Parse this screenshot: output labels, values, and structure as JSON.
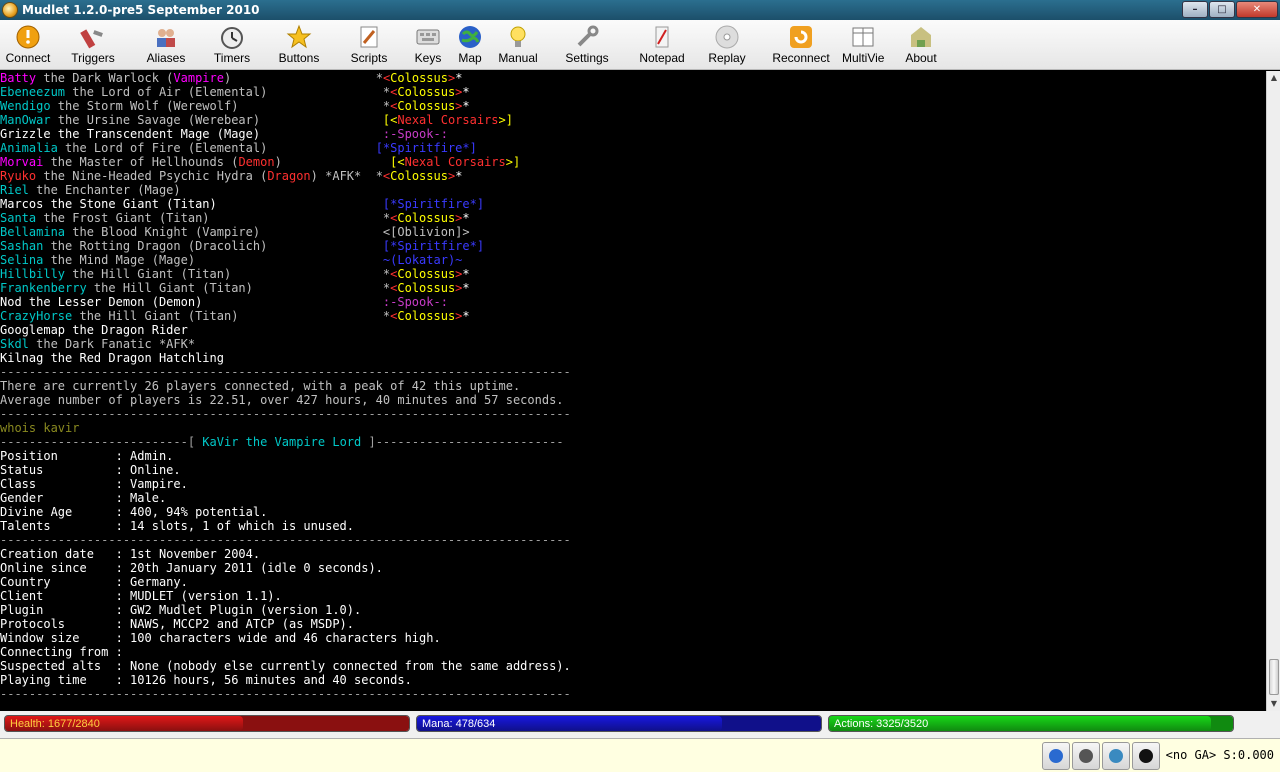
{
  "window": {
    "title": "Mudlet 1.2.0-pre5 September 2010"
  },
  "toolbar": [
    {
      "name": "connect",
      "label": "Connect"
    },
    {
      "name": "triggers",
      "label": "Triggers"
    },
    {
      "name": "aliases",
      "label": "Aliases"
    },
    {
      "name": "timers",
      "label": "Timers"
    },
    {
      "name": "buttons",
      "label": "Buttons"
    },
    {
      "name": "scripts",
      "label": "Scripts"
    },
    {
      "name": "keys",
      "label": "Keys"
    },
    {
      "name": "map",
      "label": "Map"
    },
    {
      "name": "manual",
      "label": "Manual"
    },
    {
      "name": "settings",
      "label": "Settings"
    },
    {
      "name": "notepad",
      "label": "Notepad"
    },
    {
      "name": "replay",
      "label": "Replay"
    },
    {
      "name": "reconnect",
      "label": "Reconnect"
    },
    {
      "name": "multiview",
      "label": "MultiView"
    },
    {
      "name": "about",
      "label": "About"
    }
  ],
  "colors": {
    "magenta": "#ff00ff",
    "cyan": "#00c8c8",
    "red": "#ff3030",
    "white": "#ffffff",
    "yellow": "#ffff00",
    "blue": "#3a3aff",
    "spook": "#c83cc8",
    "dash": "#a0a0a0",
    "cmd": "#8a8a20",
    "grey": "#c0c0c0"
  },
  "console": {
    "lines": [
      [
        [
          "Batty",
          "magenta"
        ],
        [
          " the Dark Warlock (",
          "grey"
        ],
        [
          "Vampire",
          "magenta"
        ],
        [
          ")                    *",
          "grey"
        ],
        [
          "<",
          "red"
        ],
        [
          "Colossus",
          "yellow"
        ],
        [
          ">",
          "red"
        ],
        [
          "*",
          "white"
        ]
      ],
      [
        [
          "Ebeneezum",
          "cyan"
        ],
        [
          " the Lord of Air (Elemental)                *",
          "grey"
        ],
        [
          "<",
          "red"
        ],
        [
          "Colossus",
          "yellow"
        ],
        [
          ">",
          "red"
        ],
        [
          "*",
          "white"
        ]
      ],
      [
        [
          "Wendigo",
          "cyan"
        ],
        [
          " the Storm Wolf (Werewolf)                    *",
          "grey"
        ],
        [
          "<",
          "red"
        ],
        [
          "Colossus",
          "yellow"
        ],
        [
          ">",
          "red"
        ],
        [
          "*",
          "white"
        ]
      ],
      [
        [
          "ManOwar",
          "cyan"
        ],
        [
          " the Ursine Savage (Werebear)                 ",
          "grey"
        ],
        [
          "[<",
          "yellow"
        ],
        [
          "Nexal Corsairs",
          "red"
        ],
        [
          ">]",
          "yellow"
        ]
      ],
      [
        [
          "Grizzle the Transcendent Mage (Mage)                 ",
          "white"
        ],
        [
          ":-Spook-:",
          "spook"
        ]
      ],
      [
        [
          "Animalia",
          "cyan"
        ],
        [
          " the Lord of Fire (Elemental)               ",
          "grey"
        ],
        [
          "[*Spiritfire*]",
          "blue"
        ]
      ],
      [
        [
          "Morvai",
          "magenta"
        ],
        [
          " the Master of Hellhounds (",
          "grey"
        ],
        [
          "Demon",
          "red"
        ],
        [
          ")               ",
          "grey"
        ],
        [
          "[<",
          "yellow"
        ],
        [
          "Nexal Corsairs",
          "red"
        ],
        [
          ">]",
          "yellow"
        ]
      ],
      [
        [
          "Ryuko",
          "red"
        ],
        [
          " the Nine-Headed Psychic Hydra (",
          "grey"
        ],
        [
          "Dragon",
          "red"
        ],
        [
          ") *AFK*  *",
          "grey"
        ],
        [
          "<",
          "red"
        ],
        [
          "Colossus",
          "yellow"
        ],
        [
          ">",
          "red"
        ],
        [
          "*",
          "white"
        ]
      ],
      [
        [
          "Riel",
          "cyan"
        ],
        [
          " the Enchanter (Mage)",
          "grey"
        ]
      ],
      [
        [
          "Marcos the Stone Giant (Titan)                       ",
          "white"
        ],
        [
          "[*Spiritfire*]",
          "blue"
        ]
      ],
      [
        [
          "Santa",
          "cyan"
        ],
        [
          " the Frost Giant (Titan)                        *",
          "grey"
        ],
        [
          "<",
          "red"
        ],
        [
          "Colossus",
          "yellow"
        ],
        [
          ">",
          "red"
        ],
        [
          "*",
          "white"
        ]
      ],
      [
        [
          "Bellamina",
          "cyan"
        ],
        [
          " the Blood Knight (Vampire)                 <[Oblivion]>",
          "grey"
        ]
      ],
      [
        [
          "Sashan",
          "cyan"
        ],
        [
          " the Rotting Dragon (Dracolich)                ",
          "grey"
        ],
        [
          "[*Spiritfire*]",
          "blue"
        ]
      ],
      [
        [
          "Selina",
          "cyan"
        ],
        [
          " the Mind Mage (Mage)                          ",
          "grey"
        ],
        [
          "~(Lokatar)~",
          "blue"
        ]
      ],
      [
        [
          "Hillbilly",
          "cyan"
        ],
        [
          " the Hill Giant (Titan)                     *",
          "grey"
        ],
        [
          "<",
          "red"
        ],
        [
          "Colossus",
          "yellow"
        ],
        [
          ">",
          "red"
        ],
        [
          "*",
          "white"
        ]
      ],
      [
        [
          "Frankenberry",
          "cyan"
        ],
        [
          " the Hill Giant (Titan)                  *",
          "grey"
        ],
        [
          "<",
          "red"
        ],
        [
          "Colossus",
          "yellow"
        ],
        [
          ">",
          "red"
        ],
        [
          "*",
          "white"
        ]
      ],
      [
        [
          "Nod the Lesser Demon (Demon)                         ",
          "white"
        ],
        [
          ":-Spook-:",
          "spook"
        ]
      ],
      [
        [
          "CrazyHorse",
          "cyan"
        ],
        [
          " the Hill Giant (Titan)                    *",
          "grey"
        ],
        [
          "<",
          "red"
        ],
        [
          "Colossus",
          "yellow"
        ],
        [
          ">",
          "red"
        ],
        [
          "*",
          "white"
        ]
      ],
      [
        [
          "Googlemap the Dragon Rider",
          "white"
        ]
      ],
      [
        [
          "Skdl",
          "cyan"
        ],
        [
          " the Dark Fanatic *AFK*",
          "grey"
        ]
      ],
      [
        [
          "Kilnag the Red Dragon Hatchling",
          "white"
        ]
      ],
      [
        [
          "-------------------------------------------------------------------------------",
          "dash"
        ]
      ],
      [
        [
          "There are currently 26 players connected, with a peak of 42 this uptime.",
          "grey"
        ]
      ],
      [
        [
          "Average number of players is 22.51, over 427 hours, 40 minutes and 57 seconds.",
          "grey"
        ]
      ],
      [
        [
          "-------------------------------------------------------------------------------",
          "dash"
        ]
      ],
      [
        [
          "whois kavir",
          "cmd"
        ]
      ],
      [
        [
          "--------------------------[ ",
          "dash"
        ],
        [
          "KaVir the Vampire Lord",
          "cyan"
        ],
        [
          " ]--------------------------",
          "dash"
        ]
      ],
      [
        [
          "Position        : Admin.",
          "white"
        ]
      ],
      [
        [
          "Status          : Online.",
          "white"
        ]
      ],
      [
        [
          "Class           : Vampire.",
          "white"
        ]
      ],
      [
        [
          "Gender          : Male.",
          "white"
        ]
      ],
      [
        [
          "Divine Age      : 400, 94% potential.",
          "white"
        ]
      ],
      [
        [
          "Talents         : 14 slots, 1 of which is unused.",
          "white"
        ]
      ],
      [
        [
          "-------------------------------------------------------------------------------",
          "dash"
        ]
      ],
      [
        [
          "Creation date   : 1st November 2004.",
          "white"
        ]
      ],
      [
        [
          "Online since    : 20th January 2011 (idle 0 seconds).",
          "white"
        ]
      ],
      [
        [
          "Country         : Germany.",
          "white"
        ]
      ],
      [
        [
          "Client          : MUDLET (version 1.1).",
          "white"
        ]
      ],
      [
        [
          "Plugin          : GW2 Mudlet Plugin (version 1.0).",
          "white"
        ]
      ],
      [
        [
          "Protocols       : NAWS, MCCP2 and ATCP (as MSDP).",
          "white"
        ]
      ],
      [
        [
          "Window size     : 100 characters wide and 46 characters high.",
          "white"
        ]
      ],
      [
        [
          "Connecting from :",
          "white"
        ]
      ],
      [
        [
          "Suspected alts  : None (nobody else currently connected from the same address).",
          "white"
        ]
      ],
      [
        [
          "Playing time    : 10126 hours, 56 minutes and 40 seconds.",
          "white"
        ]
      ],
      [
        [
          "-------------------------------------------------------------------------------",
          "dash"
        ]
      ]
    ]
  },
  "gauges": [
    {
      "name": "health",
      "label": "Health: 1677/2840",
      "fraction": 0.59,
      "fill": "#e01818",
      "bg": "#8a1010",
      "text": "#ffd040"
    },
    {
      "name": "mana",
      "label": "Mana: 478/634",
      "fraction": 0.754,
      "fill": "#1818e0",
      "bg": "#10108a",
      "text": "#ffffff"
    },
    {
      "name": "actions",
      "label": "Actions: 3325/3520",
      "fraction": 0.945,
      "fill": "#18d818",
      "bg": "#108a10",
      "text": "#ffffff"
    }
  ],
  "statusbar": {
    "text": "<no GA> S:0.000",
    "icons": [
      "info-icon",
      "keyboard-icon",
      "screen-icon",
      "record-icon"
    ]
  }
}
